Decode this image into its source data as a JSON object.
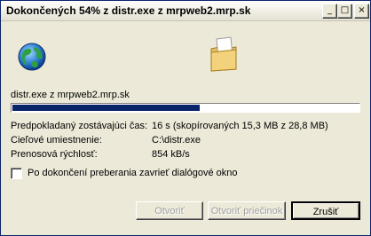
{
  "window": {
    "title": "Dokončených 54% z distr.exe z mrpweb2.mrp.sk",
    "buttons": {
      "minimize": "_",
      "maximize": "□",
      "close": "×"
    }
  },
  "download": {
    "source_line": "distr.exe z mrpweb2.mrp.sk",
    "progress_percent": 54,
    "rows": [
      {
        "label": "Predpokladaný zostávajúci čas:",
        "value": "16 s (skopírovaných 15,3 MB z 28,8 MB)"
      },
      {
        "label": "Cieľové umiestnenie:",
        "value": "C:\\distr.exe"
      },
      {
        "label": "Prenosová rýchlosť:",
        "value": "854 kB/s"
      }
    ],
    "close_on_finish_label": "Po dokončení preberania zavrieť dialógové okno",
    "close_on_finish_checked": false
  },
  "actions": {
    "open_label": "Otvoriť",
    "open_folder_label": "Otvoriť priečinok",
    "close_label": "Zrušiť"
  },
  "icons": {
    "globe": "globe-icon",
    "folder": "folder-icon"
  }
}
